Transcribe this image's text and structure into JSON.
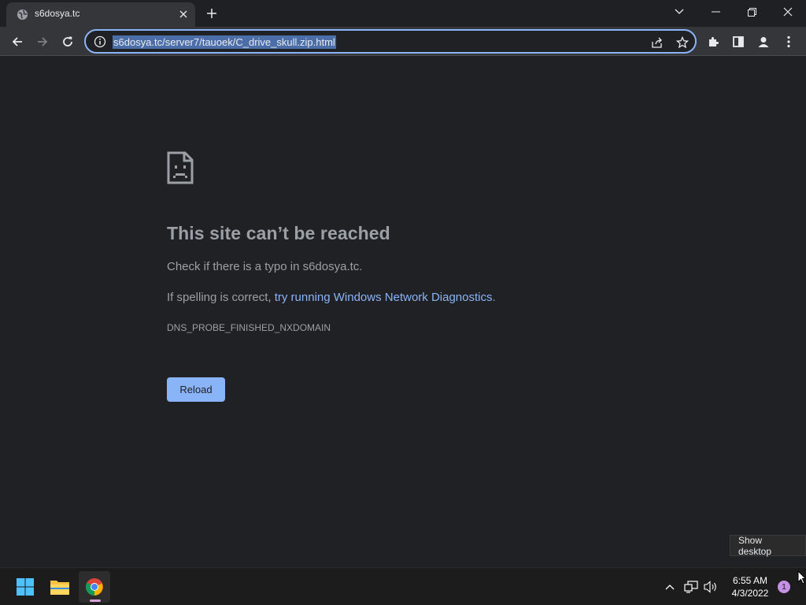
{
  "browser": {
    "tab": {
      "title": "s6dosya.tc",
      "favicon": "globe-icon"
    },
    "omnibox": {
      "url": "s6dosya.tc/server7/tauoek/C_drive_skull.zip.html"
    },
    "colors": {
      "accent": "#8ab4f8",
      "background": "#202124",
      "toolbar": "#35363a"
    }
  },
  "error_page": {
    "icon": "sad-page-icon",
    "title": "This site can’t be reached",
    "line1": "Check if there is a typo in s6dosya.tc.",
    "line2_prefix": "If spelling is correct, ",
    "line2_link": "try running Windows Network Diagnostics",
    "line2_suffix": ".",
    "error_code": "DNS_PROBE_FINISHED_NXDOMAIN",
    "reload_label": "Reload"
  },
  "tooltip": {
    "text": "Show desktop"
  },
  "taskbar": {
    "apps": [
      "windows-start-icon",
      "file-explorer-icon",
      "chrome-icon"
    ],
    "time": "6:55 AM",
    "date": "4/3/2022",
    "notification_count": "1"
  }
}
